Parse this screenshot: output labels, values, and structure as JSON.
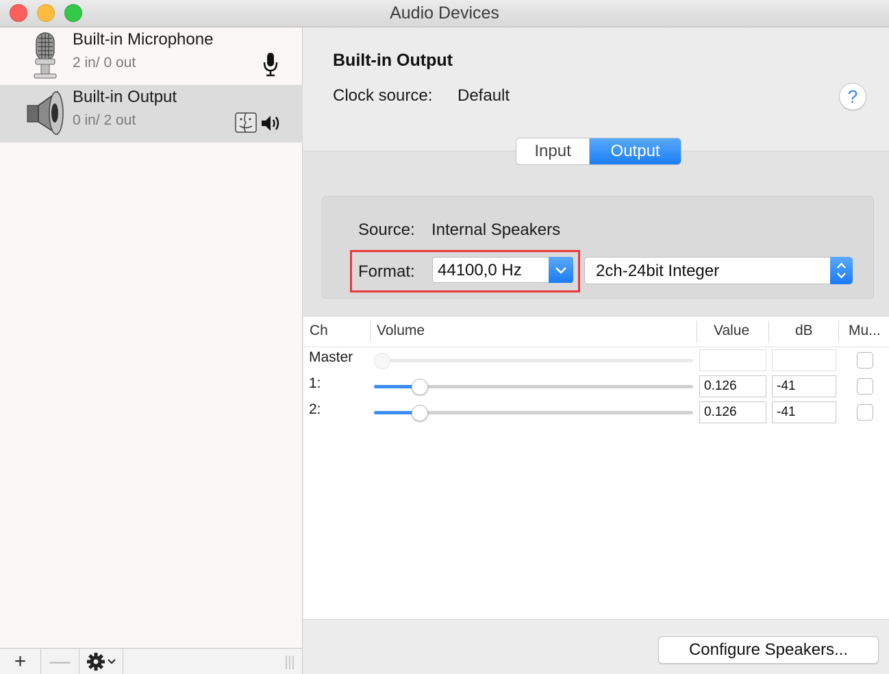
{
  "window": {
    "title": "Audio Devices"
  },
  "sidebar": {
    "devices": [
      {
        "name": "Built-in Microphone",
        "io": "2 in/ 0 out",
        "icon": "microphone-icon"
      },
      {
        "name": "Built-in Output",
        "io": "0 in/ 2 out",
        "icon": "speaker-icon",
        "selected": true
      }
    ],
    "toolbar": {
      "add_label": "+",
      "remove_label": "—"
    }
  },
  "detail": {
    "device_title": "Built-in Output",
    "clock_label": "Clock source:",
    "clock_value": "Default",
    "help_label": "?",
    "tabs": [
      {
        "label": "Input",
        "selected": false
      },
      {
        "label": "Output",
        "selected": true
      }
    ],
    "source_label": "Source:",
    "source_value": "Internal Speakers",
    "format_label": "Format:",
    "sample_rate": "44100,0 Hz",
    "sample_format": "2ch-24bit Integer",
    "accent_color": "#1c7ef5",
    "highlight_color": "#e8383b"
  },
  "table": {
    "headers": {
      "ch": "Ch",
      "volume": "Volume",
      "value": "Value",
      "db": "dB",
      "mute": "Mu..."
    },
    "rows": [
      {
        "ch": "Master",
        "volume_level": null,
        "value": "",
        "db": "",
        "mute": false
      },
      {
        "ch": "1:",
        "volume_level": 0.126,
        "value": "0.126",
        "db": "-41",
        "mute": false
      },
      {
        "ch": "2:",
        "volume_level": 0.126,
        "value": "0.126",
        "db": "-41",
        "mute": false
      }
    ]
  },
  "footer": {
    "configure_label": "Configure Speakers..."
  }
}
